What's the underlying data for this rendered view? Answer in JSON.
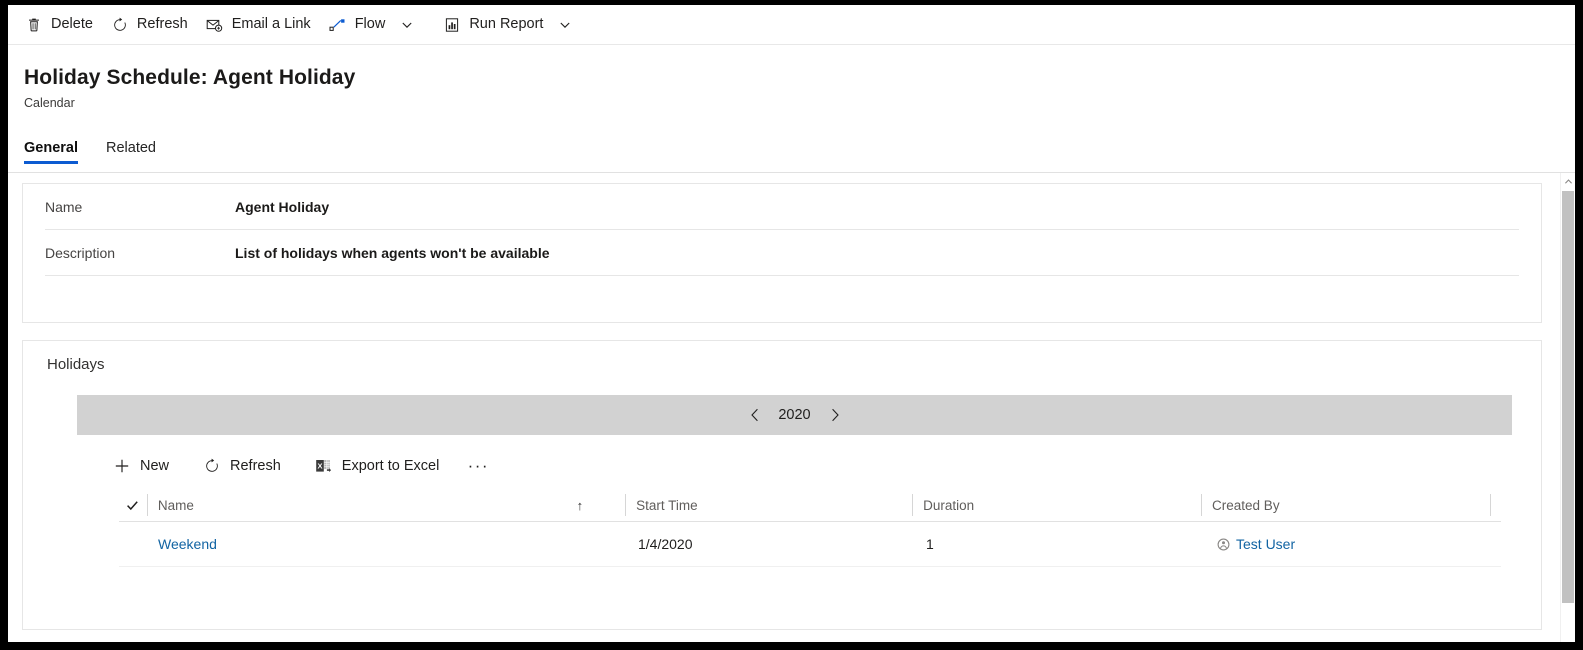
{
  "command_bar": {
    "buttons": [
      {
        "label": "Delete",
        "icon": "trash-icon",
        "has_caret": false
      },
      {
        "label": "Refresh",
        "icon": "refresh-icon",
        "has_caret": false
      },
      {
        "label": "Email a Link",
        "icon": "email-link-icon",
        "has_caret": false
      },
      {
        "label": "Flow",
        "icon": "flow-icon",
        "has_caret": true
      },
      {
        "label": "Run Report",
        "icon": "report-icon",
        "has_caret": true
      }
    ]
  },
  "header": {
    "title": "Holiday Schedule: Agent Holiday",
    "subtitle": "Calendar",
    "tabs": [
      {
        "label": "General",
        "active": true
      },
      {
        "label": "Related",
        "active": false
      }
    ]
  },
  "general_section": {
    "fields": [
      {
        "label": "Name",
        "value": "Agent Holiday"
      },
      {
        "label": "Description",
        "value": "List of holidays when agents won't be available"
      }
    ]
  },
  "holidays_section": {
    "title": "Holidays",
    "year_nav": {
      "prev_label": "‹",
      "year": "2020",
      "next_label": "›"
    },
    "toolbar": [
      {
        "label": "New",
        "icon": "plus-icon"
      },
      {
        "label": "Refresh",
        "icon": "refresh-icon"
      },
      {
        "label": "Export to Excel",
        "icon": "excel-icon"
      }
    ],
    "overflow_label": "···",
    "grid": {
      "columns": [
        {
          "label": "Name",
          "sort": "↑"
        },
        {
          "label": "Start Time",
          "sort": ""
        },
        {
          "label": "Duration",
          "sort": ""
        },
        {
          "label": "Created By",
          "sort": ""
        }
      ],
      "rows": [
        {
          "name": "Weekend",
          "start_time": "1/4/2020",
          "duration": "1",
          "created_by": "Test User"
        }
      ]
    }
  },
  "colors": {
    "accent_blue": "#0c5bd1",
    "link_blue": "#1264a3",
    "year_bar_gray": "#d2d2d2",
    "scrollbar_thumb": "#c1c1c1"
  }
}
